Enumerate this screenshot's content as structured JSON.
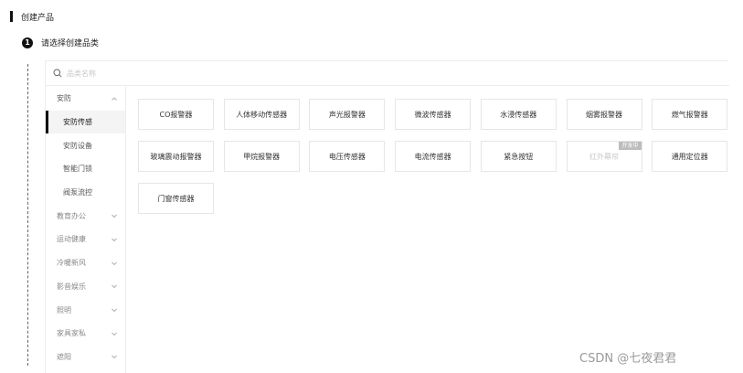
{
  "header": {
    "title": "创建产品"
  },
  "step": {
    "number": "1",
    "label": "请选择创建品类"
  },
  "search": {
    "placeholder": "品类名称",
    "icon": "search-icon"
  },
  "sidebar": {
    "open_category": "安防",
    "subitems": [
      {
        "label": "安防传感",
        "active": true
      },
      {
        "label": "安防设备",
        "active": false
      },
      {
        "label": "智能门锁",
        "active": false
      },
      {
        "label": "阀泵流控",
        "active": false
      }
    ],
    "categories": [
      "教育办公",
      "运动健康",
      "冷暖新风",
      "影音娱乐",
      "照明",
      "家具家私",
      "遮阳"
    ]
  },
  "products": [
    {
      "label": "CO报警器",
      "disabled": false
    },
    {
      "label": "人体移动传感器",
      "disabled": false
    },
    {
      "label": "声光报警器",
      "disabled": false
    },
    {
      "label": "微波传感器",
      "disabled": false
    },
    {
      "label": "水浸传感器",
      "disabled": false
    },
    {
      "label": "烟雾报警器",
      "disabled": false
    },
    {
      "label": "燃气报警器",
      "disabled": false
    },
    {
      "label": "玻璃震动报警器",
      "disabled": false
    },
    {
      "label": "甲烷报警器",
      "disabled": false
    },
    {
      "label": "电压传感器",
      "disabled": false
    },
    {
      "label": "电流传感器",
      "disabled": false
    },
    {
      "label": "紧急按钮",
      "disabled": false
    },
    {
      "label": "红外幕帘",
      "disabled": true,
      "badge": "开发中"
    },
    {
      "label": "通用定位器",
      "disabled": false
    },
    {
      "label": "门窗传感器",
      "disabled": false
    }
  ],
  "watermark": "CSDN @七夜君君",
  "colors": {
    "accent": "#111111",
    "border": "#ededed",
    "muted": "#888888",
    "badge": "#bdbdbd"
  }
}
